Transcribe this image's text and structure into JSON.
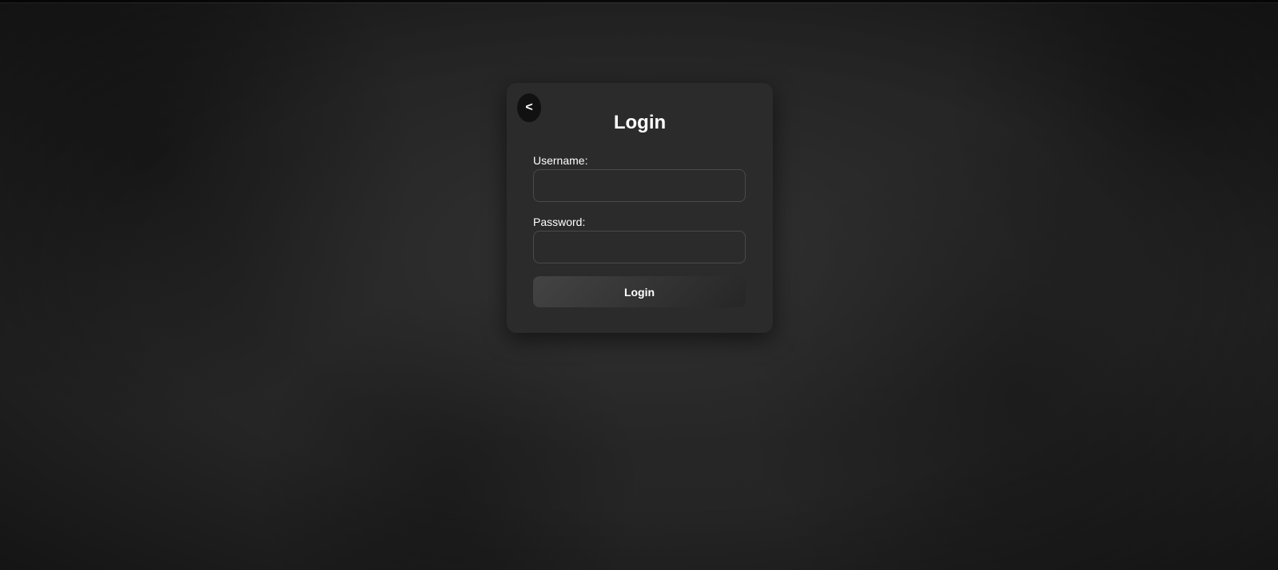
{
  "page": {
    "background_color": "#252525",
    "card_color": "#2b2b2b"
  },
  "login_form": {
    "back_button_label": "<",
    "back_icon": "chevron-left-icon",
    "title": "Login",
    "username": {
      "label": "Username:",
      "value": "",
      "placeholder": ""
    },
    "password": {
      "label": "Password:",
      "value": "",
      "placeholder": ""
    },
    "submit_label": "Login"
  }
}
